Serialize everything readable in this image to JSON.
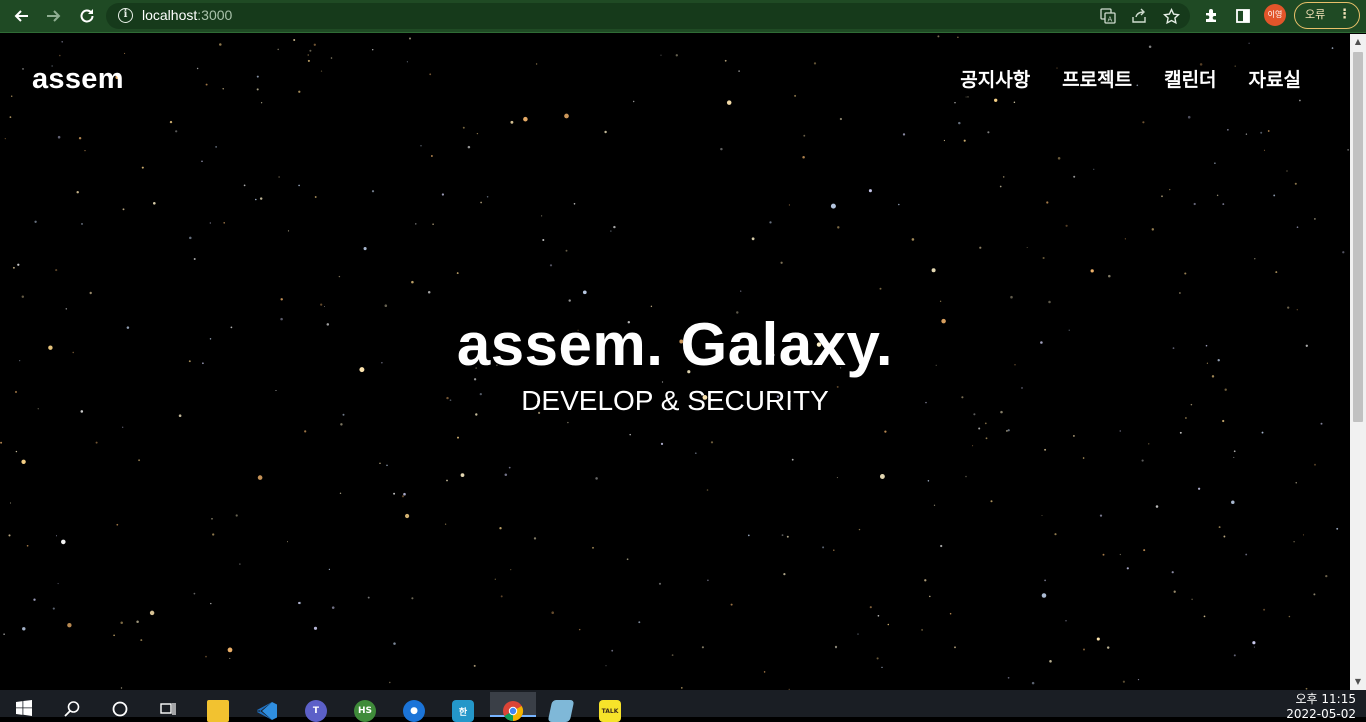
{
  "browser": {
    "url_host": "localhost",
    "url_port": ":3000",
    "avatar_label": "이영",
    "error_label": "오류",
    "colors": {
      "toolbar": "#1f4a24",
      "omnibox": "#163a1b",
      "avatar": "#e2552a",
      "error_border": "#e8c06a"
    }
  },
  "site": {
    "brand": "assem",
    "nav": [
      {
        "label": "공지사항"
      },
      {
        "label": "프로젝트"
      },
      {
        "label": "캘린더"
      },
      {
        "label": "자료실"
      }
    ],
    "hero_title": "assem. Galaxy.",
    "hero_subtitle": "DEVELOP & SECURITY",
    "background_color": "#000000"
  },
  "taskbar": {
    "apps": [
      {
        "name": "start-icon"
      },
      {
        "name": "search-icon"
      },
      {
        "name": "cortana-icon"
      },
      {
        "name": "task-view-icon"
      },
      {
        "name": "file-explorer-icon"
      },
      {
        "name": "vscode-icon"
      },
      {
        "name": "teams-icon"
      },
      {
        "name": "hs-app-icon",
        "label": "HS"
      },
      {
        "name": "maps-icon"
      },
      {
        "name": "hangul-icon",
        "label": "한"
      },
      {
        "name": "chrome-icon",
        "active": true
      },
      {
        "name": "notepad-icon"
      },
      {
        "name": "kakaotalk-icon",
        "label": "TALK"
      }
    ],
    "clock_time": "오후 11:15",
    "clock_date": "2022-05-02"
  }
}
